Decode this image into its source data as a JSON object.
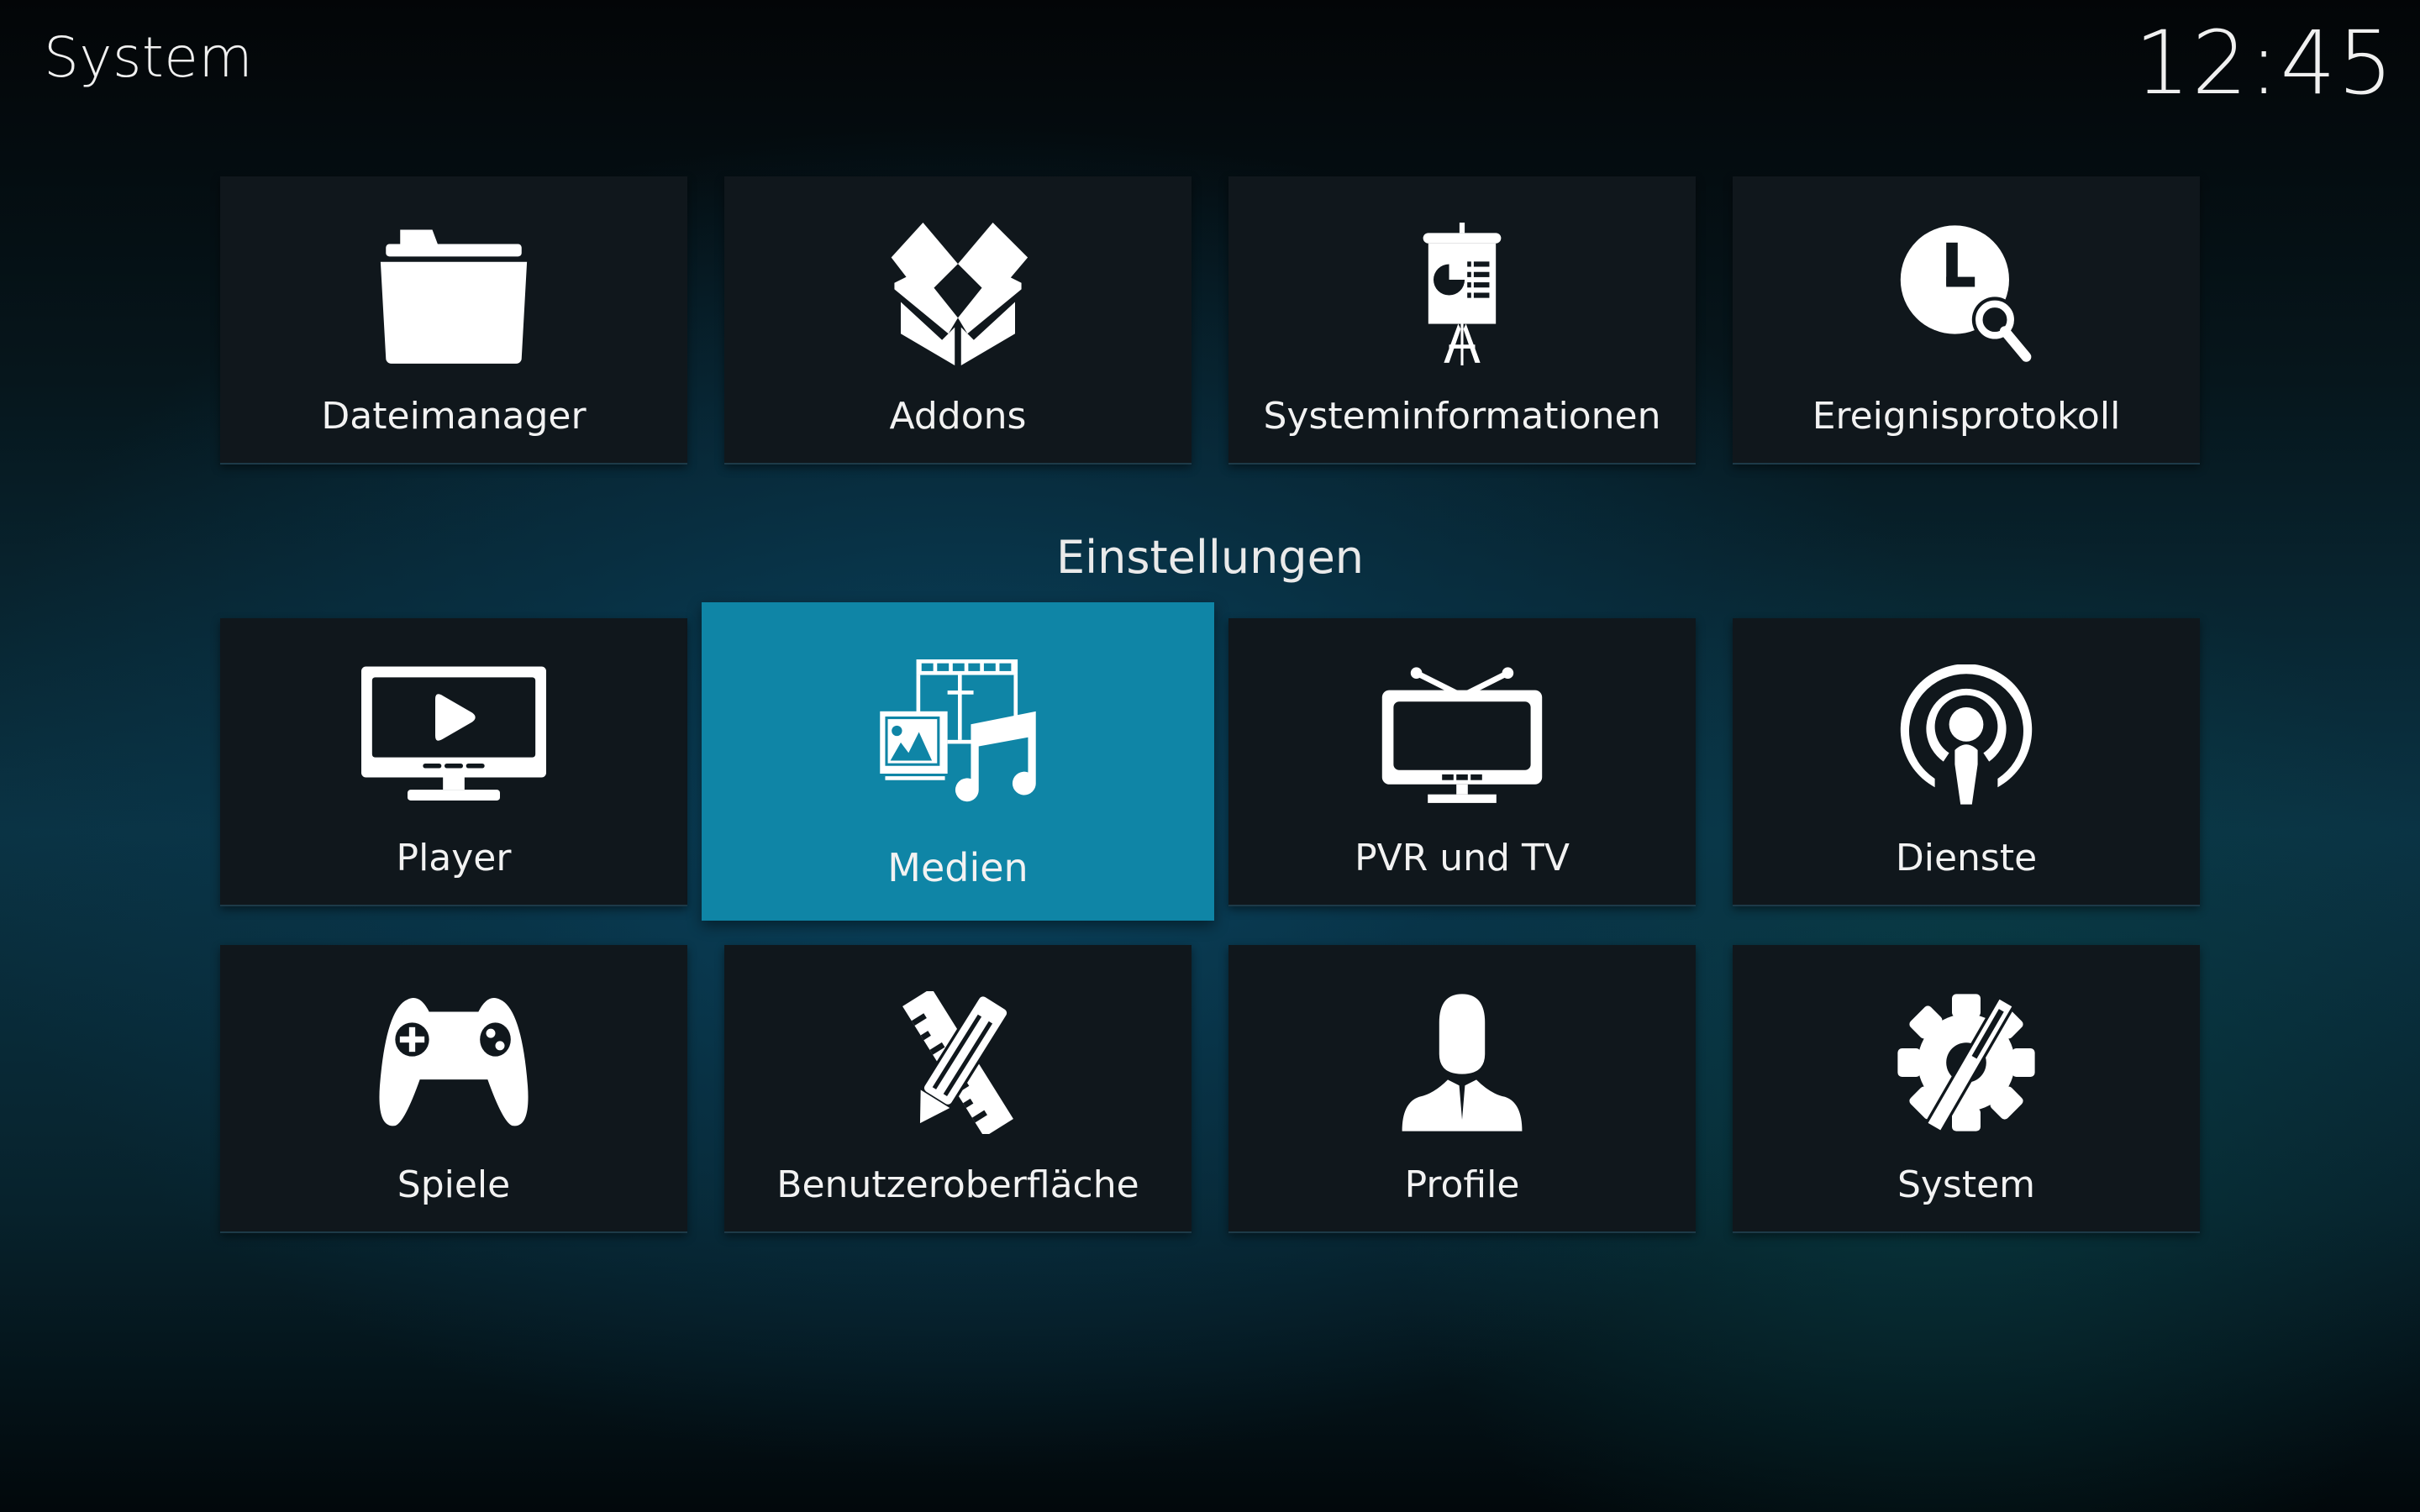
{
  "header": {
    "title": "System",
    "clock": "12:45"
  },
  "colors": {
    "accent": "#0f85a6",
    "tile_background": "#10171c",
    "text": "#f2f2f2"
  },
  "top_row": [
    {
      "label": "Dateimanager",
      "icon": "folder-icon"
    },
    {
      "label": "Addons",
      "icon": "open-box-icon"
    },
    {
      "label": "Systeminformationen",
      "icon": "presentation-board-icon"
    },
    {
      "label": "Ereignisprotokoll",
      "icon": "clock-search-icon"
    }
  ],
  "settings_section": {
    "title": "Einstellungen",
    "selected": "Medien",
    "items": [
      {
        "label": "Player",
        "icon": "monitor-play-icon"
      },
      {
        "label": "Medien",
        "icon": "media-icon"
      },
      {
        "label": "PVR und TV",
        "icon": "tv-antenna-icon"
      },
      {
        "label": "Dienste",
        "icon": "podcast-broadcast-icon"
      },
      {
        "label": "Spiele",
        "icon": "gamepad-icon"
      },
      {
        "label": "Benutzeroberfläche",
        "icon": "ruler-pencil-icon"
      },
      {
        "label": "Profile",
        "icon": "user-profile-icon"
      },
      {
        "label": "System",
        "icon": "gear-wrench-icon"
      }
    ]
  }
}
